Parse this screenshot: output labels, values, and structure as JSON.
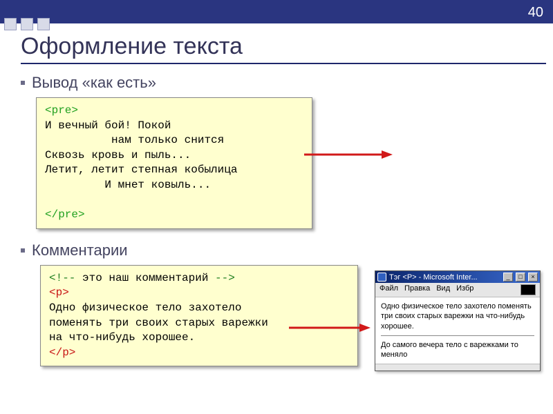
{
  "page_number": "40",
  "title": "Оформление текста",
  "sections": {
    "asis": {
      "label": "Вывод «как есть»",
      "code": {
        "open_tag": "<pre>",
        "line1": "И вечный бой! Покой",
        "line2": "          нам только снится",
        "line3": "Сквозь кровь и пыль...",
        "line4": "Летит, летит степная кобылица",
        "line5": "         И мнет ковыль...",
        "close_tag": "</pre>"
      }
    },
    "comments": {
      "label": "Комментарии",
      "code": {
        "cmt_open": "<!--",
        "cmt_text": " это наш комментарий ",
        "cmt_close": "-->",
        "p_open": "<p>",
        "body1": "Одно физическое тело захотело",
        "body2": "поменять три своих старых варежки",
        "body3": "на что-нибудь хорошее.",
        "p_close": "</p>"
      }
    }
  },
  "browser": {
    "title": "Тэг <P> - Microsoft Inter...",
    "menu": {
      "file": "Файл",
      "edit": "Правка",
      "view": "Вид",
      "fav": "Избр"
    },
    "buttons": {
      "min": "_",
      "max": "□",
      "close": "×"
    },
    "para1": "Одно физическое тело захотело поменять три своих старых варежки на что-нибудь хорошее.",
    "para2": "До самого вечера тело с варежками то меняло"
  },
  "colors": {
    "accent": "#2a3580",
    "code_bg": "#ffffcf",
    "arrow": "#d11919"
  }
}
